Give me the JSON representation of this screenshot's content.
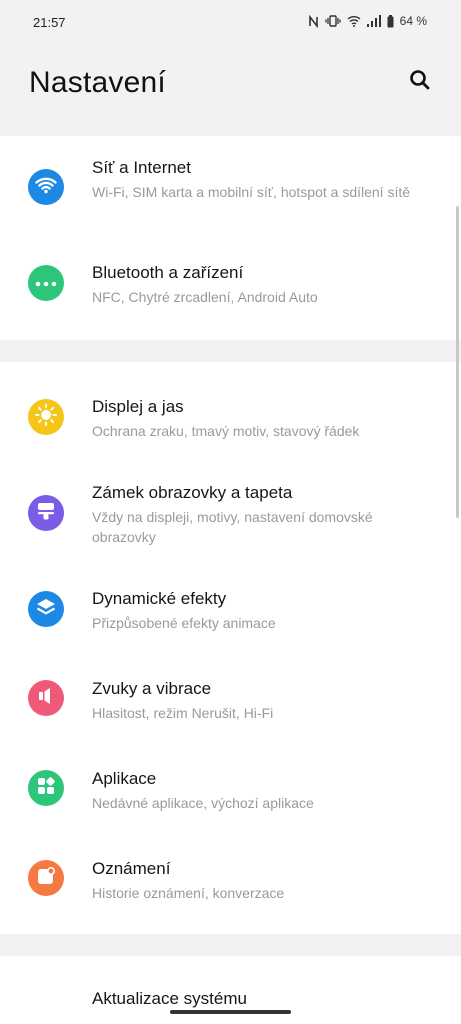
{
  "status_bar": {
    "time": "21:57",
    "battery": "64 %",
    "icons": [
      "nfc-icon",
      "vibrate-icon",
      "wifi-icon",
      "signal-icon",
      "battery-icon"
    ]
  },
  "header": {
    "title": "Nastavení",
    "search_icon": "search-icon"
  },
  "groups": [
    {
      "items": [
        {
          "title": "Síť a Internet",
          "subtitle": "Wi-Fi, SIM karta a mobilní síť, hotspot a sdílení sítě",
          "icon": "wifi-icon",
          "color": "#1e88e5"
        },
        {
          "title": "Bluetooth a zařízení",
          "subtitle": "NFC, Chytré zrcadlení, Android Auto",
          "icon": "more-dots-icon",
          "color": "#2dc57a"
        }
      ]
    },
    {
      "items": [
        {
          "title": "Displej a jas",
          "subtitle": "Ochrana zraku, tmavý motiv, stavový řádek",
          "icon": "brightness-icon",
          "color": "#f5c518"
        },
        {
          "title": "Zámek obrazovky a tapeta",
          "subtitle": "Vždy na displeji, motivy, nastavení domovské obrazovky",
          "icon": "lock-screen-icon",
          "color": "#7b5ce6"
        },
        {
          "title": "Dynamické efekty",
          "subtitle": "Přizpůsobené efekty animace",
          "icon": "layers-icon",
          "color": "#1e88e5"
        },
        {
          "title": "Zvuky a vibrace",
          "subtitle": "Hlasitost, režim Nerušit, Hi-Fi",
          "icon": "sound-icon",
          "color": "#ef5a7a"
        },
        {
          "title": "Aplikace",
          "subtitle": "Nedávné aplikace, výchozí aplikace",
          "icon": "apps-icon",
          "color": "#2dc57a"
        },
        {
          "title": "Oznámení",
          "subtitle": "Historie oznámení, konverzace",
          "icon": "notification-icon",
          "color": "#f47a42"
        }
      ]
    },
    {
      "items": [
        {
          "title": "Aktualizace systému",
          "subtitle": "",
          "icon": "",
          "color": ""
        }
      ]
    }
  ]
}
